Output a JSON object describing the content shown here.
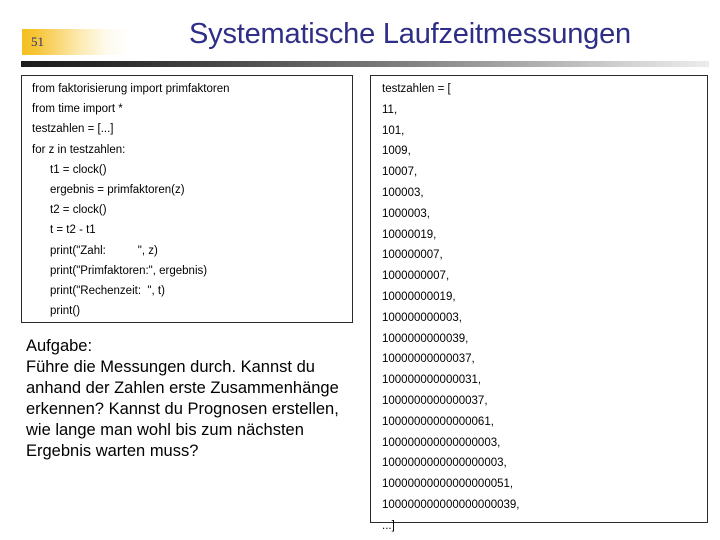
{
  "header": {
    "page_number": "51",
    "title": "Systematische Laufzeitmessungen",
    "title_color": "#2e2e86",
    "badge_color": "#f3c020"
  },
  "code_panel": {
    "lines": [
      {
        "text": "from faktorisierung import primfaktoren",
        "indent": 0
      },
      {
        "text": "from time import *",
        "indent": 0
      },
      {
        "text": "testzahlen = [...]",
        "indent": 0
      },
      {
        "text": "for z in testzahlen:",
        "indent": 0
      },
      {
        "text": "t1 = clock()",
        "indent": 1
      },
      {
        "text": "ergebnis = primfaktoren(z)",
        "indent": 1
      },
      {
        "text": "t2 = clock()",
        "indent": 1
      },
      {
        "text": "t = t2 - t1",
        "indent": 1
      },
      {
        "text": "print(\"Zahl:          \", z)",
        "indent": 1
      },
      {
        "text": "print(\"Primfaktoren:\", ergebnis)",
        "indent": 1
      },
      {
        "text": "print(\"Rechenzeit:  \", t)",
        "indent": 1
      },
      {
        "text": "print()",
        "indent": 1
      }
    ]
  },
  "numbers_panel": {
    "lines": [
      "testzahlen = [",
      "11,",
      "101,",
      "1009,",
      "10007,",
      "100003,",
      "1000003,",
      "10000019,",
      "100000007,",
      "1000000007,",
      "10000000019,",
      "100000000003,",
      "1000000000039,",
      "10000000000037,",
      "100000000000031,",
      "1000000000000037,",
      "10000000000000061,",
      "100000000000000003,",
      "1000000000000000003,",
      "10000000000000000051,",
      "100000000000000000039,",
      "...]"
    ]
  },
  "aufgabe": {
    "lines": [
      "Aufgabe:",
      "Führe die Messungen durch. Kannst du",
      "anhand der Zahlen erste Zusammenhänge",
      "erkennen? Kannst du Prognosen erstellen,",
      "wie lange man wohl bis zum nächsten",
      "Ergebnis warten muss?"
    ]
  }
}
